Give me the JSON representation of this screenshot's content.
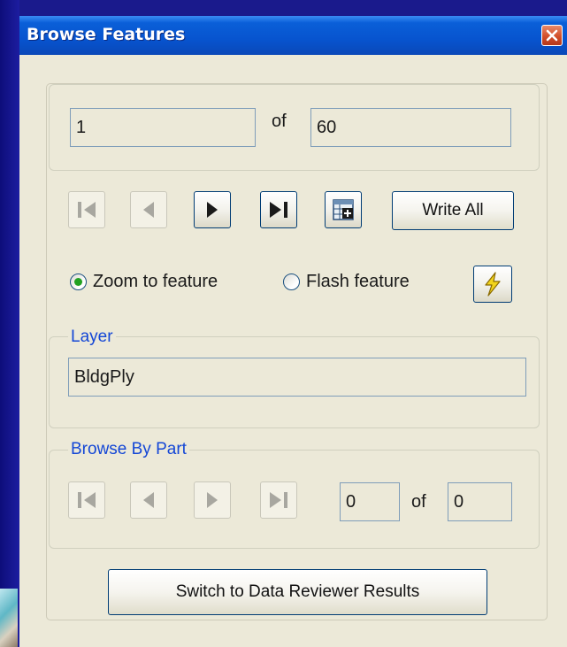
{
  "window": {
    "title": "Browse Features",
    "close_icon": "close-icon"
  },
  "record": {
    "current": "1",
    "of_label": "of",
    "total": "60"
  },
  "navigation": {
    "first_icon": "first-record-icon",
    "previous_icon": "previous-record-icon",
    "next_icon": "next-record-icon",
    "last_icon": "last-record-icon",
    "write_record_icon": "table-add-icon",
    "write_all_label": "Write All"
  },
  "display_options": {
    "zoom_label": "Zoom to feature",
    "flash_label": "Flash feature",
    "selected": "zoom",
    "flash_icon": "lightning-icon"
  },
  "layer": {
    "group_label": "Layer",
    "value": "BldgPly"
  },
  "browse_by_part": {
    "group_label": "Browse By Part",
    "current": "0",
    "of_label": "of",
    "total": "0"
  },
  "switch_button_label": "Switch to Data Reviewer Results",
  "colors": {
    "title_bar": "#0754cf",
    "group_label": "#1447d6",
    "panel": "#ece9d8",
    "close_button": "#d24f2a"
  }
}
